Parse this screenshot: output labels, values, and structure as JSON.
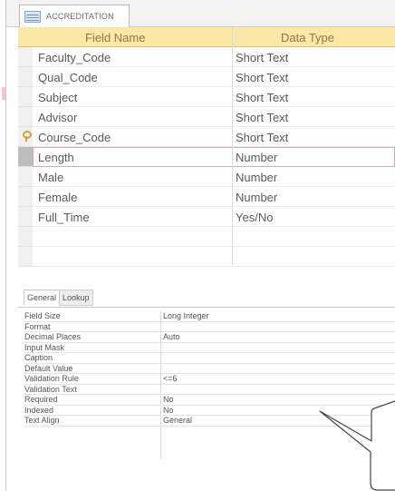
{
  "tab": {
    "label": "ACCREDITATION"
  },
  "grid": {
    "headers": {
      "field_name": "Field Name",
      "data_type": "Data Type"
    },
    "rows": [
      {
        "field": "Faculty_Code",
        "type": "Short Text"
      },
      {
        "field": "Qual_Code",
        "type": "Short Text"
      },
      {
        "field": "Subject",
        "type": "Short Text"
      },
      {
        "field": "Advisor",
        "type": "Short Text"
      },
      {
        "field": "Course_Code",
        "type": "Short Text"
      },
      {
        "field": "Length",
        "type": "Number"
      },
      {
        "field": "Male",
        "type": "Number"
      },
      {
        "field": "Female",
        "type": "Number"
      },
      {
        "field": "Full_Time",
        "type": "Yes/No"
      }
    ]
  },
  "properties": {
    "tabs": [
      "General",
      "Lookup"
    ],
    "rows": [
      {
        "label": "Field Size",
        "value": "Long Integer"
      },
      {
        "label": "Format",
        "value": ""
      },
      {
        "label": "Decimal Places",
        "value": "Auto"
      },
      {
        "label": "Input Mask",
        "value": ""
      },
      {
        "label": "Caption",
        "value": ""
      },
      {
        "label": "Default Value",
        "value": ""
      },
      {
        "label": "Validation Rule",
        "value": "<=6"
      },
      {
        "label": "Validation Text",
        "value": ""
      },
      {
        "label": "Required",
        "value": "No"
      },
      {
        "label": "Indexed",
        "value": "No"
      },
      {
        "label": "Text Align",
        "value": "General"
      }
    ]
  },
  "colors": {
    "header_bg": "#fbe8a6",
    "current_row_border": "#e7a3b0",
    "callout_stroke": "#444444"
  }
}
